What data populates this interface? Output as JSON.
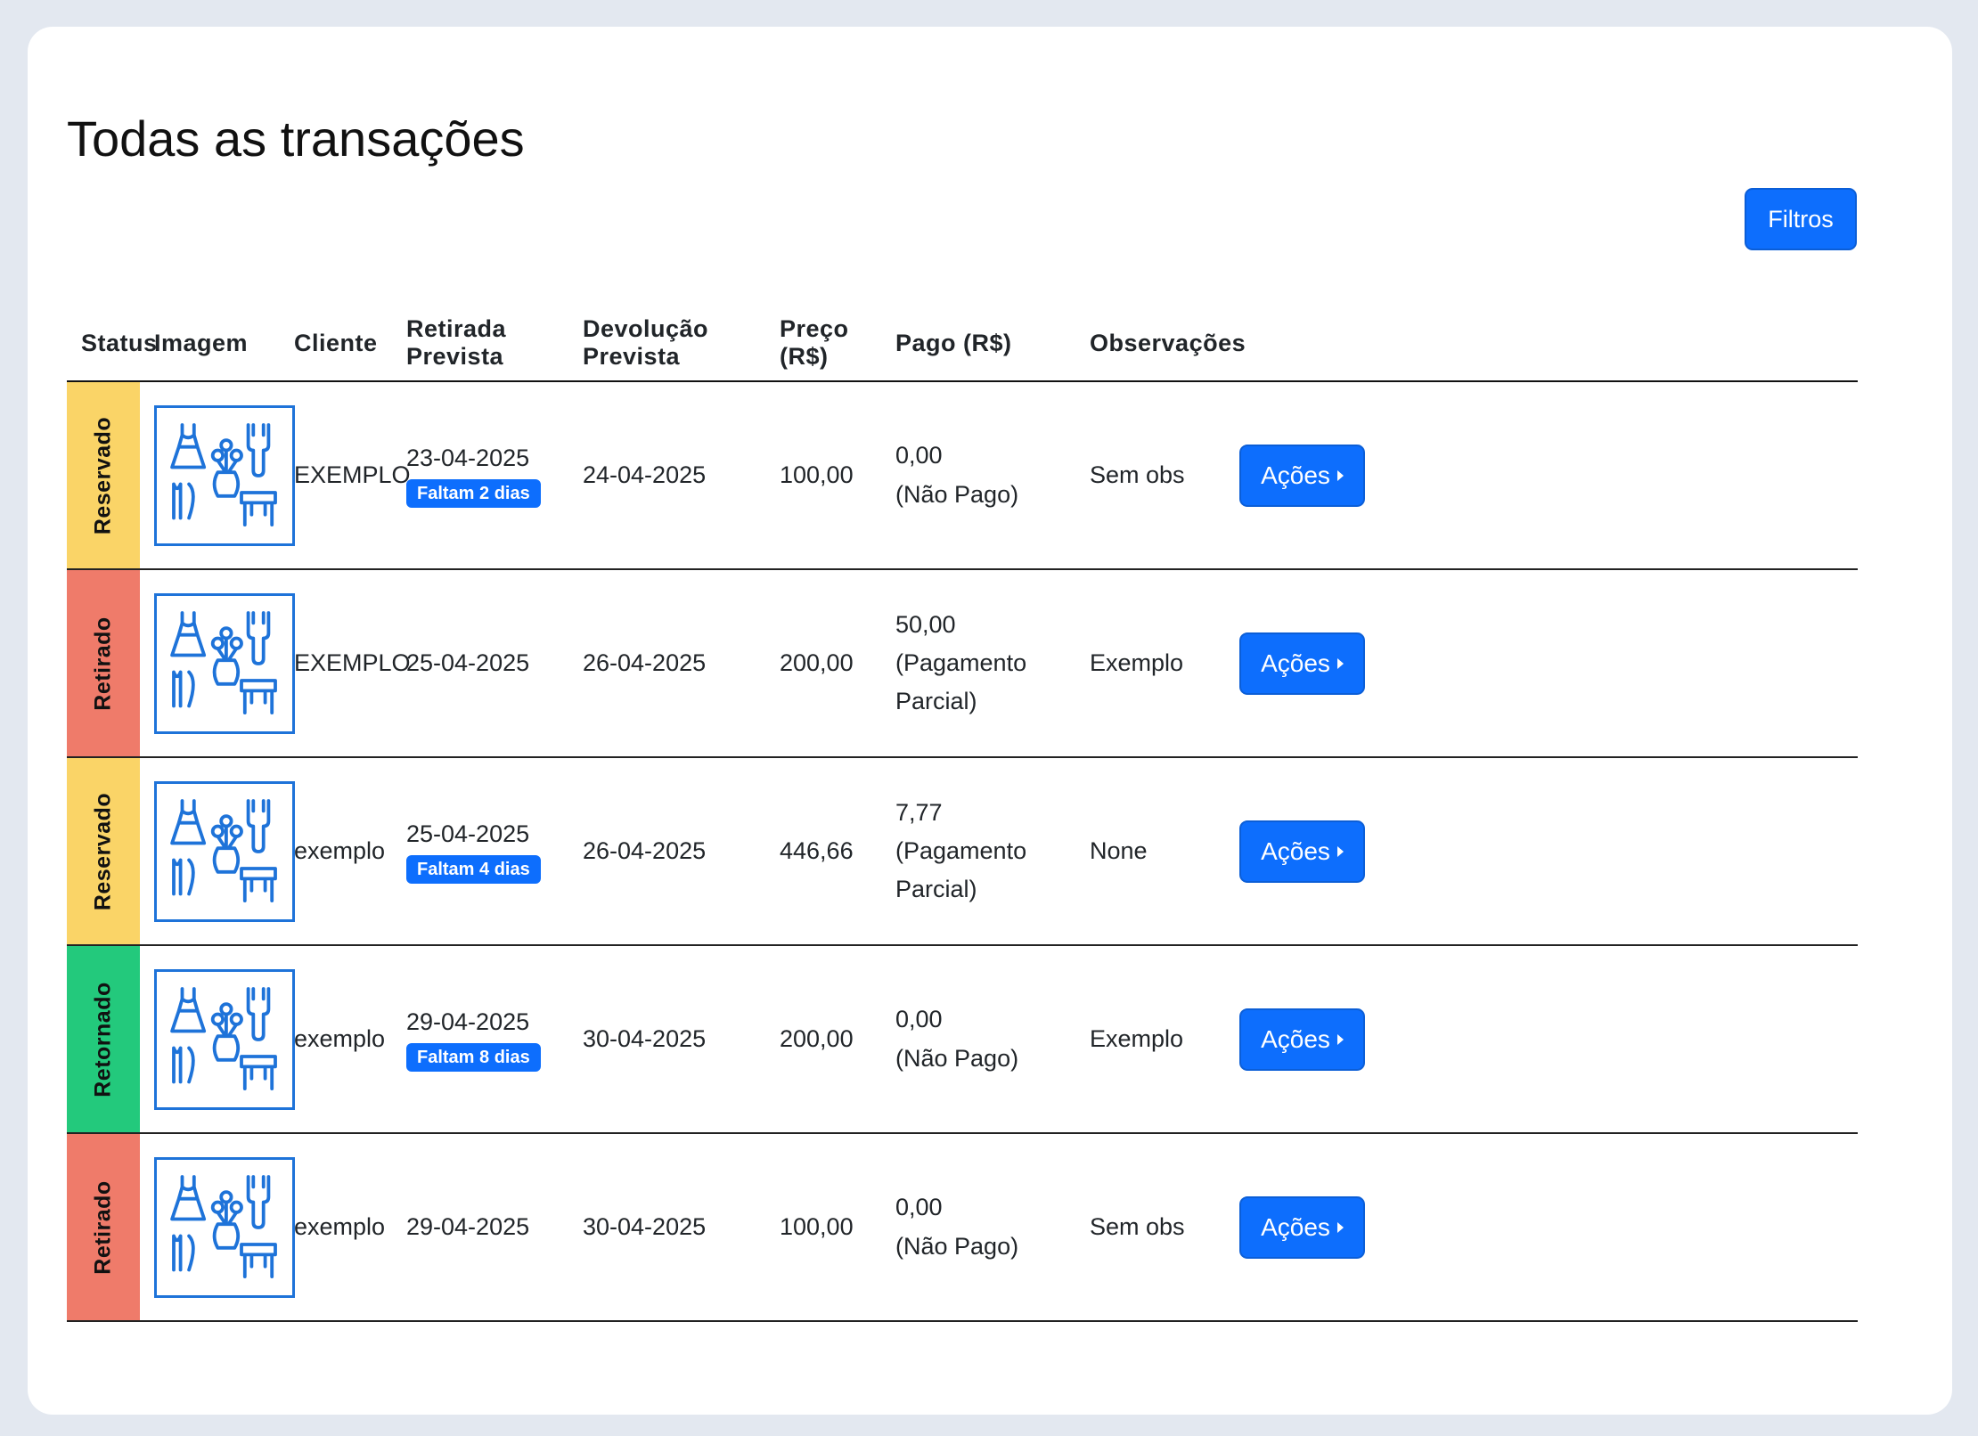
{
  "page": {
    "title": "Todas as transações",
    "filters_label": "Filtros"
  },
  "colors": {
    "accent": "#0d6efd",
    "status_reservado": "#fad467",
    "status_retirado": "#ef7b6a",
    "status_retornado": "#23c97c"
  },
  "table": {
    "headers": [
      "Status",
      "Imagem",
      "Cliente",
      "Retirada Prevista",
      "Devolução Prevista",
      "Preço (R$)",
      "Pago (R$)",
      "Observações",
      ""
    ],
    "action_label": "Ações",
    "rows": [
      {
        "status": "Reservado",
        "status_color": "#fad467",
        "image_icon": "household-items-icon",
        "client": "EXEMPLO",
        "pickup": "23-04-2025",
        "badge": "Faltam 2 dias",
        "return": "24-04-2025",
        "price": "100,00",
        "paid_amount": "0,00",
        "paid_status": "(Não Pago)",
        "notes": "Sem obs"
      },
      {
        "status": "Retirado",
        "status_color": "#ef7b6a",
        "image_icon": "household-items-icon",
        "client": "EXEMPLO",
        "pickup": "25-04-2025",
        "badge": "",
        "return": "26-04-2025",
        "price": "200,00",
        "paid_amount": "50,00",
        "paid_status": "(Pagamento Parcial)",
        "notes": "Exemplo"
      },
      {
        "status": "Reservado",
        "status_color": "#fad467",
        "image_icon": "household-items-icon",
        "client": "exemplo",
        "pickup": "25-04-2025",
        "badge": "Faltam 4 dias",
        "return": "26-04-2025",
        "price": "446,66",
        "paid_amount": "7,77",
        "paid_status": "(Pagamento Parcial)",
        "notes": "None"
      },
      {
        "status": "Retornado",
        "status_color": "#23c97c",
        "image_icon": "household-items-icon",
        "client": "exemplo",
        "pickup": "29-04-2025",
        "badge": "Faltam 8 dias",
        "return": "30-04-2025",
        "price": "200,00",
        "paid_amount": "0,00",
        "paid_status": "(Não Pago)",
        "notes": "Exemplo"
      },
      {
        "status": "Retirado",
        "status_color": "#ef7b6a",
        "image_icon": "household-items-icon",
        "client": "exemplo",
        "pickup": "29-04-2025",
        "badge": "",
        "return": "30-04-2025",
        "price": "100,00",
        "paid_amount": "0,00",
        "paid_status": "(Não Pago)",
        "notes": "Sem obs"
      }
    ]
  }
}
